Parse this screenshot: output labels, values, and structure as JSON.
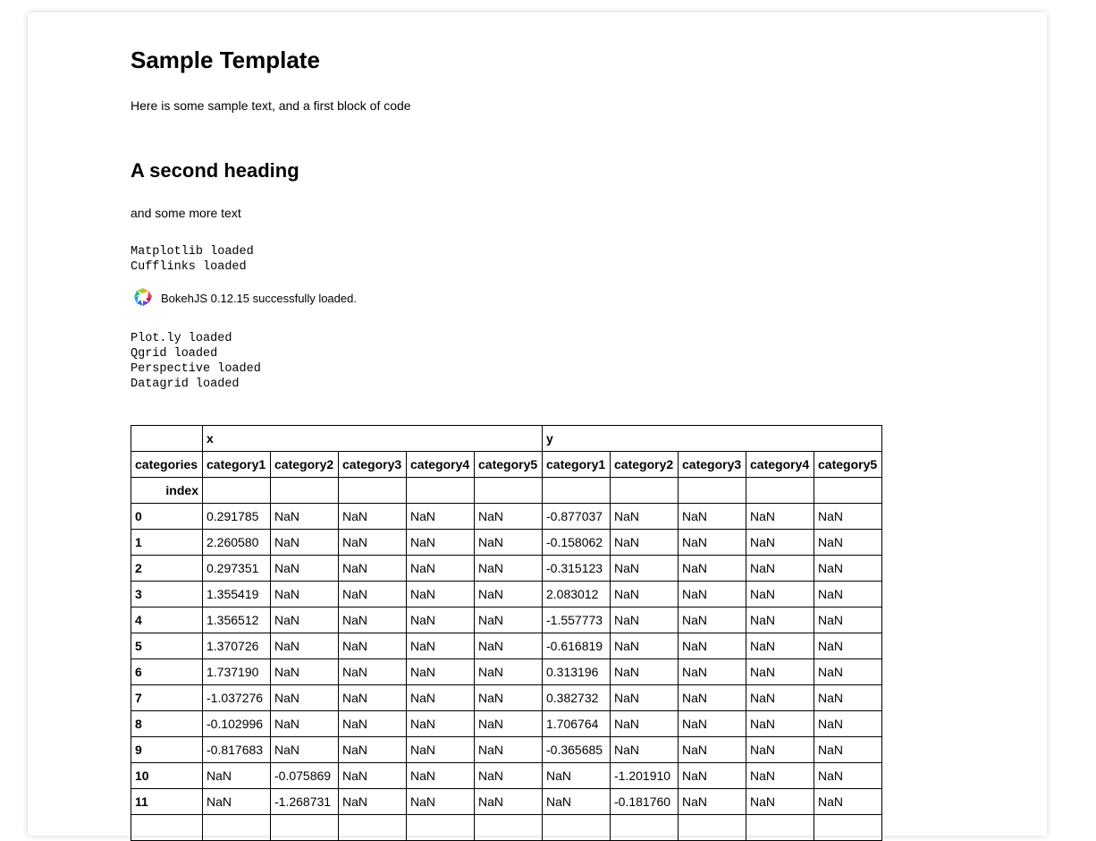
{
  "title": "Sample Template",
  "intro_text": "Here is some sample text, and a first block of code",
  "second_heading": "A second heading",
  "more_text": "and some more text",
  "code_block_1": "Matplotlib loaded\nCufflinks loaded",
  "bokeh_status": "BokehJS 0.12.15 successfully loaded.",
  "code_block_2": "Plot.ly loaded\nQgrid loaded\nPerspective loaded\nDatagrid loaded",
  "table": {
    "group_headers": [
      "x",
      "y"
    ],
    "categories_label": "categories",
    "index_label": "index",
    "columns": [
      "category1",
      "category2",
      "category3",
      "category4",
      "category5",
      "category1",
      "category2",
      "category3",
      "category4",
      "category5"
    ],
    "rows": [
      {
        "index": "0",
        "cells": [
          "0.291785",
          "NaN",
          "NaN",
          "NaN",
          "NaN",
          "-0.877037",
          "NaN",
          "NaN",
          "NaN",
          "NaN"
        ]
      },
      {
        "index": "1",
        "cells": [
          "2.260580",
          "NaN",
          "NaN",
          "NaN",
          "NaN",
          "-0.158062",
          "NaN",
          "NaN",
          "NaN",
          "NaN"
        ]
      },
      {
        "index": "2",
        "cells": [
          "0.297351",
          "NaN",
          "NaN",
          "NaN",
          "NaN",
          "-0.315123",
          "NaN",
          "NaN",
          "NaN",
          "NaN"
        ]
      },
      {
        "index": "3",
        "cells": [
          "1.355419",
          "NaN",
          "NaN",
          "NaN",
          "NaN",
          "2.083012",
          "NaN",
          "NaN",
          "NaN",
          "NaN"
        ]
      },
      {
        "index": "4",
        "cells": [
          "1.356512",
          "NaN",
          "NaN",
          "NaN",
          "NaN",
          "-1.557773",
          "NaN",
          "NaN",
          "NaN",
          "NaN"
        ]
      },
      {
        "index": "5",
        "cells": [
          "1.370726",
          "NaN",
          "NaN",
          "NaN",
          "NaN",
          "-0.616819",
          "NaN",
          "NaN",
          "NaN",
          "NaN"
        ]
      },
      {
        "index": "6",
        "cells": [
          "1.737190",
          "NaN",
          "NaN",
          "NaN",
          "NaN",
          "0.313196",
          "NaN",
          "NaN",
          "NaN",
          "NaN"
        ]
      },
      {
        "index": "7",
        "cells": [
          "-1.037276",
          "NaN",
          "NaN",
          "NaN",
          "NaN",
          "0.382732",
          "NaN",
          "NaN",
          "NaN",
          "NaN"
        ]
      },
      {
        "index": "8",
        "cells": [
          "-0.102996",
          "NaN",
          "NaN",
          "NaN",
          "NaN",
          "1.706764",
          "NaN",
          "NaN",
          "NaN",
          "NaN"
        ]
      },
      {
        "index": "9",
        "cells": [
          "-0.817683",
          "NaN",
          "NaN",
          "NaN",
          "NaN",
          "-0.365685",
          "NaN",
          "NaN",
          "NaN",
          "NaN"
        ]
      },
      {
        "index": "10",
        "cells": [
          "NaN",
          "-0.075869",
          "NaN",
          "NaN",
          "NaN",
          "NaN",
          "-1.201910",
          "NaN",
          "NaN",
          "NaN"
        ]
      },
      {
        "index": "11",
        "cells": [
          "NaN",
          "-1.268731",
          "NaN",
          "NaN",
          "NaN",
          "NaN",
          "-0.181760",
          "NaN",
          "NaN",
          "NaN"
        ]
      },
      {
        "index": "",
        "cells": [
          "",
          "",
          "",
          "",
          "",
          "",
          "",
          "",
          "",
          ""
        ]
      }
    ]
  },
  "icons": {
    "bokeh_logo": "bokeh-logo-icon"
  }
}
